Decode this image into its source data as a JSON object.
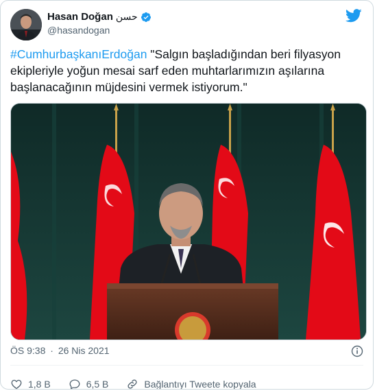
{
  "author": {
    "display_name": "Hasan Doğan",
    "arabic_name": "حسن",
    "handle": "@hasandogan"
  },
  "tweet": {
    "hashtag": "#CumhurbaşkanıErdoğan",
    "text": " \"Salgın başladığından beri filyasyon ekipleriyle yoğun mesai sarf eden muhtarlarımızın aşılarına başlanacağının müjdesini vermek istiyorum.\""
  },
  "meta": {
    "time": "ÖS 9:38",
    "separator": "·",
    "date": "26 Nis 2021"
  },
  "actions": {
    "likes": "1,8 B",
    "replies": "6,5 B",
    "copy_link": "Bağlantıyı Tweete kopyala"
  },
  "colors": {
    "accent": "#1d9bf0",
    "text": "#0f1419",
    "secondary": "#536471",
    "flag_red": "#e30a17"
  },
  "icons": [
    "twitter-bird-icon",
    "verified-badge-icon",
    "info-icon",
    "heart-icon",
    "reply-icon",
    "link-icon"
  ]
}
